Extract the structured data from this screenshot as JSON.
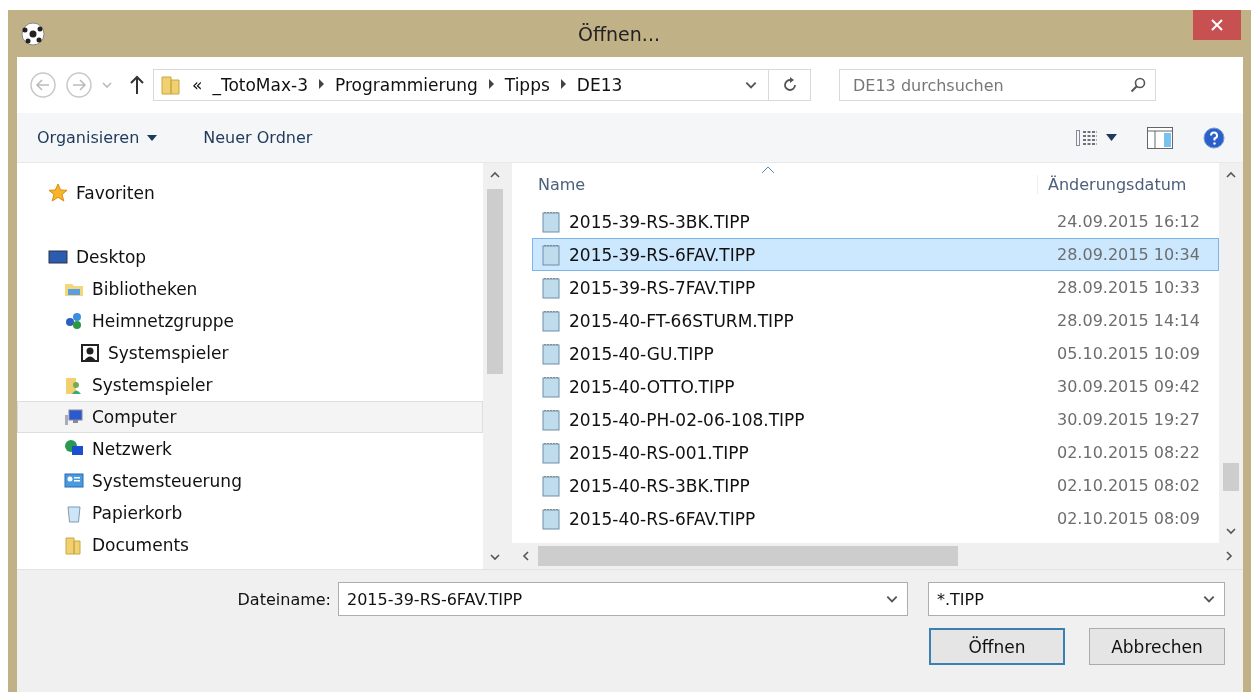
{
  "window": {
    "title": "Öffnen..."
  },
  "address_bar": {
    "overflow": "«",
    "segments": [
      "_TotoMax-3",
      "Programmierung",
      "Tipps",
      "DE13"
    ]
  },
  "search": {
    "placeholder": "DE13 durchsuchen"
  },
  "toolbar": {
    "organize": "Organisieren",
    "new_folder": "Neuer Ordner"
  },
  "navigation": [
    {
      "label": "Favoriten",
      "kind": "star",
      "selected": false
    },
    {
      "label": "Desktop",
      "kind": "desktop",
      "selected": false,
      "children": [
        {
          "label": "Bibliotheken",
          "kind": "library",
          "selected": false
        },
        {
          "label": "Heimnetzgruppe",
          "kind": "homegroup",
          "selected": false,
          "children": [
            {
              "label": "Systemspieler",
              "kind": "user",
              "selected": false
            }
          ]
        },
        {
          "label": "Systemspieler",
          "kind": "userfolder",
          "selected": false
        },
        {
          "label": "Computer",
          "kind": "computer",
          "selected": true
        },
        {
          "label": "Netzwerk",
          "kind": "network",
          "selected": false
        },
        {
          "label": "Systemsteuerung",
          "kind": "control",
          "selected": false
        },
        {
          "label": "Papierkorb",
          "kind": "bin",
          "selected": false
        },
        {
          "label": "Documents",
          "kind": "folder",
          "selected": false
        }
      ]
    }
  ],
  "file_list": {
    "columns": [
      "Name",
      "Änderungsdatum"
    ],
    "rows": [
      {
        "name": "2015-39-RS-3BK.TIPP",
        "date": "24.09.2015 16:12",
        "selected": false
      },
      {
        "name": "2015-39-RS-6FAV.TIPP",
        "date": "28.09.2015 10:34",
        "selected": true
      },
      {
        "name": "2015-39-RS-7FAV.TIPP",
        "date": "28.09.2015 10:33",
        "selected": false
      },
      {
        "name": "2015-40-FT-66STURM.TIPP",
        "date": "28.09.2015 14:14",
        "selected": false
      },
      {
        "name": "2015-40-GU.TIPP",
        "date": "05.10.2015 10:09",
        "selected": false
      },
      {
        "name": "2015-40-OTTO.TIPP",
        "date": "30.09.2015 09:42",
        "selected": false
      },
      {
        "name": "2015-40-PH-02-06-108.TIPP",
        "date": "30.09.2015 19:27",
        "selected": false
      },
      {
        "name": "2015-40-RS-001.TIPP",
        "date": "02.10.2015 08:22",
        "selected": false
      },
      {
        "name": "2015-40-RS-3BK.TIPP",
        "date": "02.10.2015 08:02",
        "selected": false
      },
      {
        "name": "2015-40-RS-6FAV.TIPP",
        "date": "02.10.2015 08:09",
        "selected": false
      }
    ]
  },
  "filename": {
    "label": "Dateiname:",
    "value": "2015-39-RS-6FAV.TIPP"
  },
  "filter": {
    "value": "*.TIPP"
  },
  "buttons": [
    {
      "label": "Öffnen",
      "default": true
    },
    {
      "label": "Abbrechen",
      "default": false
    }
  ]
}
